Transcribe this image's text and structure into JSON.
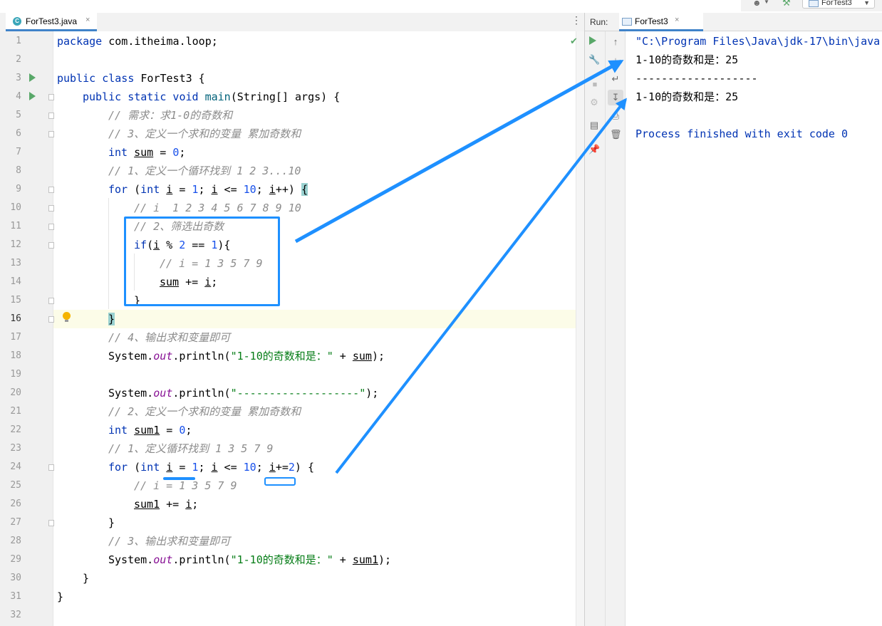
{
  "editor": {
    "tab_label": "ForTest3.java",
    "tab_close": "×",
    "line_numbers": [
      "1",
      "2",
      "3",
      "4",
      "5",
      "6",
      "7",
      "8",
      "9",
      "10",
      "11",
      "12",
      "13",
      "14",
      "15",
      "16",
      "17",
      "18",
      "19",
      "20",
      "21",
      "22",
      "23",
      "24",
      "25",
      "26",
      "27",
      "28",
      "29",
      "30",
      "31",
      "32"
    ],
    "current_line": "16",
    "code": {
      "l1": [
        "package",
        " com.itheima.loop;"
      ],
      "l3": [
        "public class",
        " ForTest3 {"
      ],
      "l4": [
        "public static void",
        "main",
        "(String[] args) {"
      ],
      "l5": "// 需求：求1-0的奇数和",
      "l6": "// 3、定义一个求和的变量 累加奇数和",
      "l7": [
        "int",
        "sum",
        " = ",
        "0",
        ";"
      ],
      "l8": "// 1、定义一个循环找到 1 2 3...10",
      "l9": [
        "for",
        " (",
        "int",
        "i",
        " = ",
        "1",
        "; ",
        "i",
        " <= ",
        "10",
        "; ",
        "i",
        "++) ",
        "{"
      ],
      "l10": "// i  1 2 3 4 5 6 7 8 9 10",
      "l11": "// 2、筛选出奇数",
      "l12": [
        "if",
        "(",
        "i",
        " % ",
        "2",
        " == ",
        "1",
        "){"
      ],
      "l13": "// i = 1 3 5 7 9",
      "l14": [
        "sum",
        " += ",
        "i",
        ";"
      ],
      "l15": "}",
      "l16": "}",
      "l17": "// 4、输出求和变量即可",
      "l18": [
        "System.",
        "out",
        ".println(",
        "\"1-10的奇数和是：\"",
        " + ",
        "sum",
        ");"
      ],
      "l20": [
        "System.",
        "out",
        ".println(",
        "\"-------------------\"",
        ");"
      ],
      "l21": "// 2、定义一个求和的变量 累加奇数和",
      "l22": [
        "int",
        "sum1",
        " = ",
        "0",
        ";"
      ],
      "l23": "// 1、定义循环找到 1 3 5 7 9",
      "l24": [
        "for",
        " (",
        "int",
        "i",
        " = ",
        "1",
        "; ",
        "i",
        " <= ",
        "10",
        "; ",
        "i",
        "+=",
        "2",
        ") {"
      ],
      "l25": "// i = 1 3 5 7 9",
      "l26": [
        "sum1",
        " += ",
        "i",
        ";"
      ],
      "l27": "}",
      "l28": "// 3、输出求和变量即可",
      "l29": [
        "System.",
        "out",
        ".println(",
        "\"1-10的奇数和是：\"",
        " + ",
        "sum1",
        ");"
      ],
      "l30": "}",
      "l31": "}"
    }
  },
  "run_panel": {
    "label": "Run:",
    "tab_label": "ForTest3",
    "tab_close": "×",
    "output": [
      "\"C:\\Program Files\\Java\\jdk-17\\bin\\java.",
      "1-10的奇数和是：25",
      "-------------------",
      "1-10的奇数和是：25",
      "",
      "Process finished with exit code 0"
    ]
  },
  "toolbar": {
    "run_config_label": "ForTest3"
  },
  "colors": {
    "annotation": "#1e90ff",
    "keyword": "#0033b3",
    "string": "#067d17",
    "number": "#1750eb",
    "comment": "#8c8c8c"
  },
  "icons": [
    "user-icon",
    "hammer-icon",
    "run-config-icon",
    "java-class-icon",
    "check-icon",
    "run-gutter-icon",
    "bulb-icon",
    "rerun-icon",
    "up-arrow-icon",
    "down-arrow-icon",
    "wrench-icon",
    "stop-icon",
    "soft-wrap-icon",
    "scroll-end-icon",
    "debug-icon",
    "print-icon",
    "layout-icon",
    "trash-icon",
    "pin-icon"
  ]
}
